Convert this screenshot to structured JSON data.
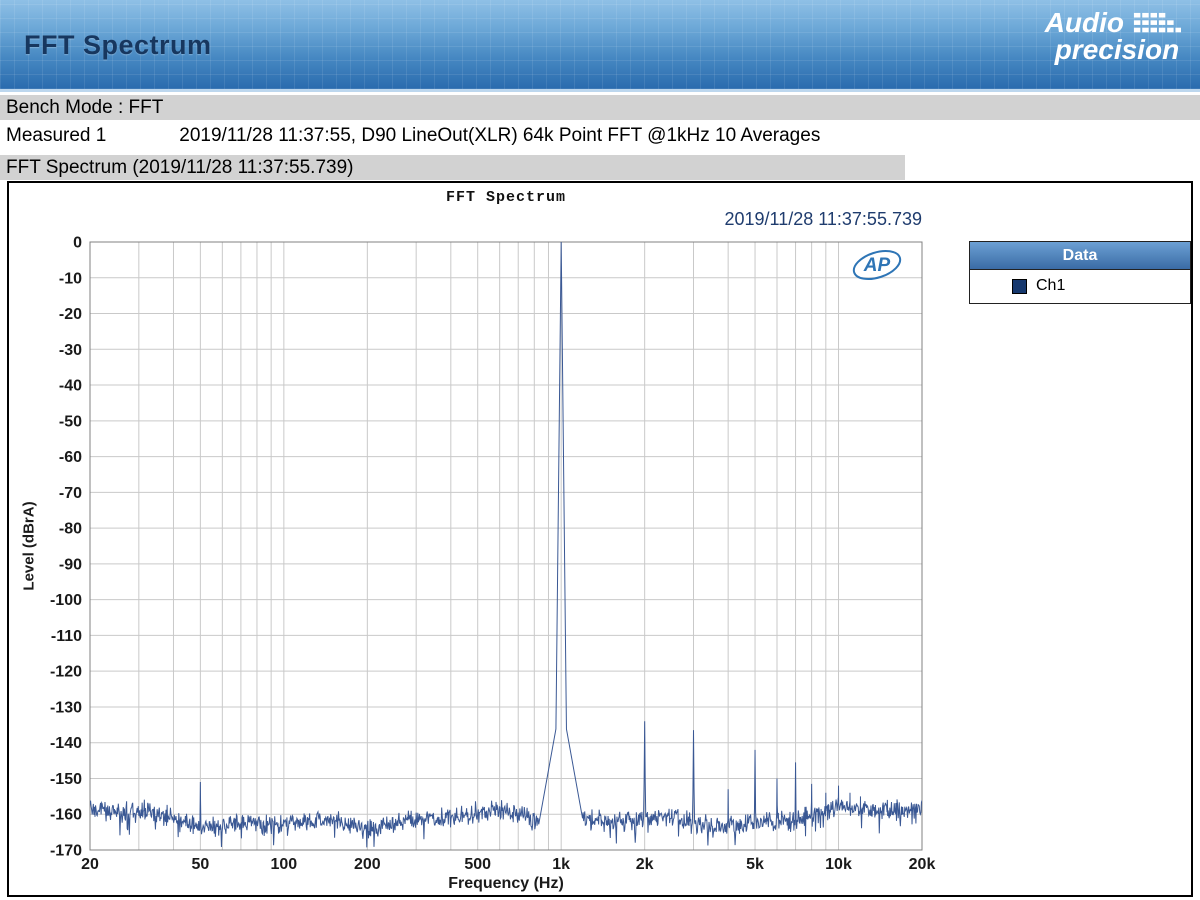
{
  "header": {
    "title": "FFT Spectrum",
    "logo_line1": "Audio",
    "logo_line2": "precision"
  },
  "info": {
    "bench_mode": "Bench Mode : FFT",
    "measured_label": "Measured 1",
    "measured_value": "2019/11/28 11:37:55, D90 LineOut(XLR) 64k Point FFT @1kHz 10 Averages",
    "section_title": "FFT Spectrum (2019/11/28 11:37:55.739)"
  },
  "legend": {
    "title": "Data",
    "entries": [
      {
        "label": "Ch1",
        "color": "#16386e"
      }
    ]
  },
  "watermark": "AP",
  "chart_data": {
    "type": "line",
    "title": "FFT Spectrum",
    "timestamp": "2019/11/28 11:37:55.739",
    "xlabel": "Frequency (Hz)",
    "ylabel": "Level (dBrA)",
    "x_scale": "log",
    "xlim": [
      20,
      20000
    ],
    "ylim": [
      -170,
      0
    ],
    "grid": true,
    "legend_position": "outside-top-right",
    "x_ticks": [
      {
        "v": 20,
        "label": "20"
      },
      {
        "v": 50,
        "label": "50"
      },
      {
        "v": 100,
        "label": "100"
      },
      {
        "v": 200,
        "label": "200"
      },
      {
        "v": 500,
        "label": "500"
      },
      {
        "v": 1000,
        "label": "1k"
      },
      {
        "v": 2000,
        "label": "2k"
      },
      {
        "v": 5000,
        "label": "5k"
      },
      {
        "v": 10000,
        "label": "10k"
      },
      {
        "v": 20000,
        "label": "20k"
      }
    ],
    "y_ticks": [
      0,
      -10,
      -20,
      -30,
      -40,
      -50,
      -60,
      -70,
      -80,
      -90,
      -100,
      -110,
      -120,
      -130,
      -140,
      -150,
      -160,
      -170
    ],
    "series": [
      {
        "name": "Ch1",
        "color": "#3a5894",
        "noise_floor_dB": -160.5,
        "fundamental": {
          "freq": 1000,
          "level": 0
        },
        "harmonics": [
          [
            2000,
            -134
          ],
          [
            3000,
            -136.5
          ],
          [
            4000,
            -153
          ],
          [
            5000,
            -142
          ],
          [
            6000,
            -150
          ],
          [
            7000,
            -145.5
          ],
          [
            8000,
            -151.5
          ],
          [
            9000,
            -154
          ],
          [
            10000,
            -152
          ],
          [
            11000,
            -154
          ],
          [
            12000,
            -155
          ],
          [
            15000,
            -156
          ]
        ],
        "spurs": [
          [
            50,
            -151
          ]
        ]
      }
    ]
  }
}
